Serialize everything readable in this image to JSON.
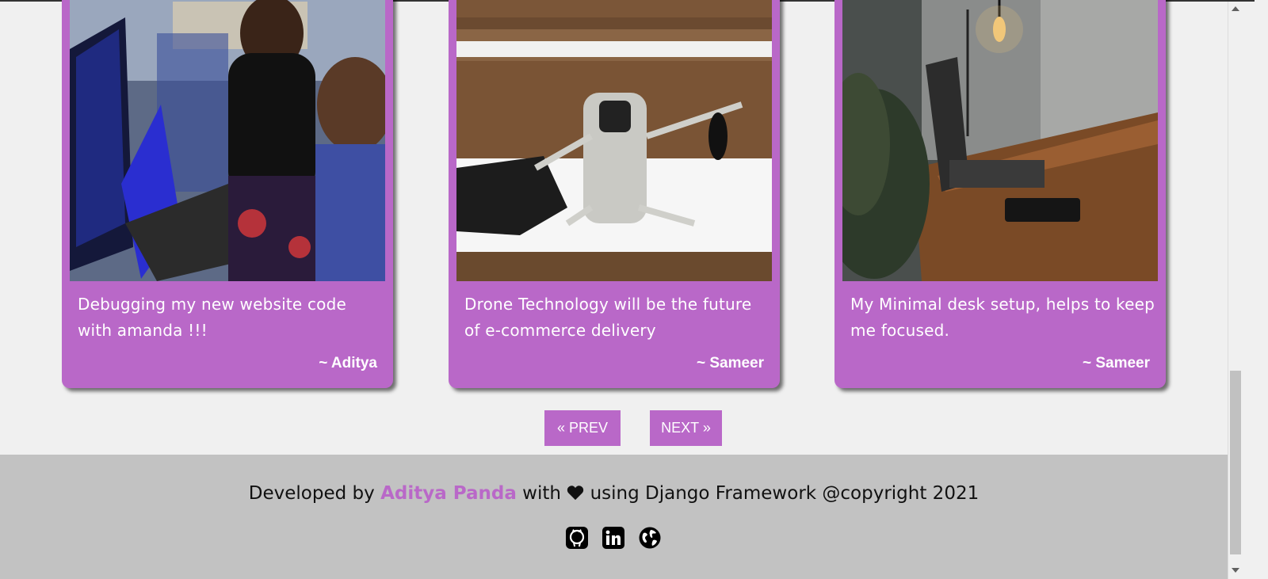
{
  "posts": [
    {
      "image_alt": "Two developers debugging code at laptop",
      "caption": "Debugging my new website code with amanda !!!",
      "author": "~ Aditya"
    },
    {
      "image_alt": "Mini drone and controller on snowy wooden steps",
      "caption": "Drone Technology will be the future of e-commerce delivery",
      "author": "~ Sameer"
    },
    {
      "image_alt": "Minimal wooden desk with laptop, phone and hanging bulb",
      "caption": "My Minimal desk setup, helps to keep me focused.",
      "author": "~ Sameer"
    }
  ],
  "pagination": {
    "prev_label": "« PREV",
    "next_label": "NEXT »"
  },
  "footer": {
    "prefix": "Developed by",
    "developer_name": "Aditya Panda",
    "mid": "with",
    "suffix": "using Django Framework @copyright 2021",
    "social_icons": [
      "github-icon",
      "linkedin-icon",
      "globe-icon"
    ]
  },
  "colors": {
    "accent": "#b968c8",
    "page_background": "#f0f0f0",
    "footer_background": "#c2c2c2"
  }
}
